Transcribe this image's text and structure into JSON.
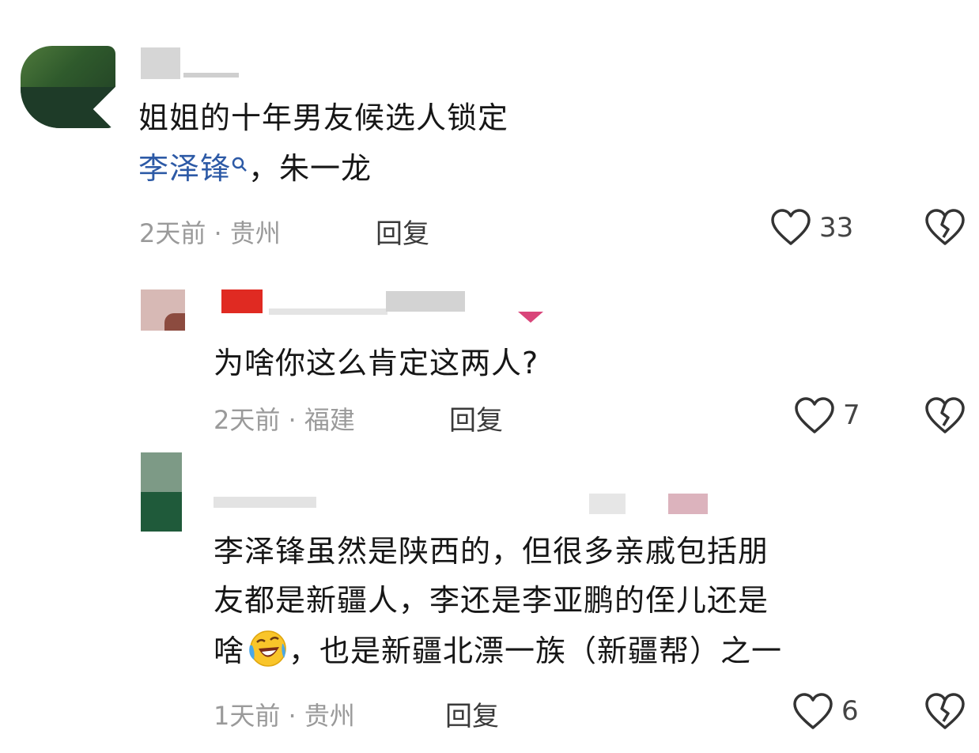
{
  "comments": [
    {
      "text_line1": "姐姐的十年男友候选人锁定",
      "link_text": "李泽锋",
      "text_line2_rest": "，朱一龙",
      "time": "2天前",
      "location": "贵州",
      "reply_label": "回复",
      "likes": "33"
    },
    {
      "text_line1": "为啥你这么肯定这两人?",
      "time": "2天前",
      "location": "福建",
      "reply_label": "回复",
      "likes": "7"
    },
    {
      "text_line1": "李泽锋虽然是陕西的，但很多亲戚包括朋",
      "text_line2": "友都是新疆人，李还是李亚鹏的侄儿还是",
      "text_line3_pre": "啥",
      "text_line3_post": "，也是新疆北漂一族（新疆帮）之一",
      "time": "1天前",
      "location": "贵州",
      "reply_label": "回复",
      "likes": "6"
    }
  ],
  "meta_separator": "·",
  "icons": {
    "like": "heart-outline-icon",
    "dislike": "broken-heart-icon",
    "search": "search-icon",
    "emoji": "laughing-crying-emoji-icon"
  },
  "colors": {
    "link": "#2d5aa6",
    "meta": "#9a9a9a",
    "text": "#161616"
  }
}
